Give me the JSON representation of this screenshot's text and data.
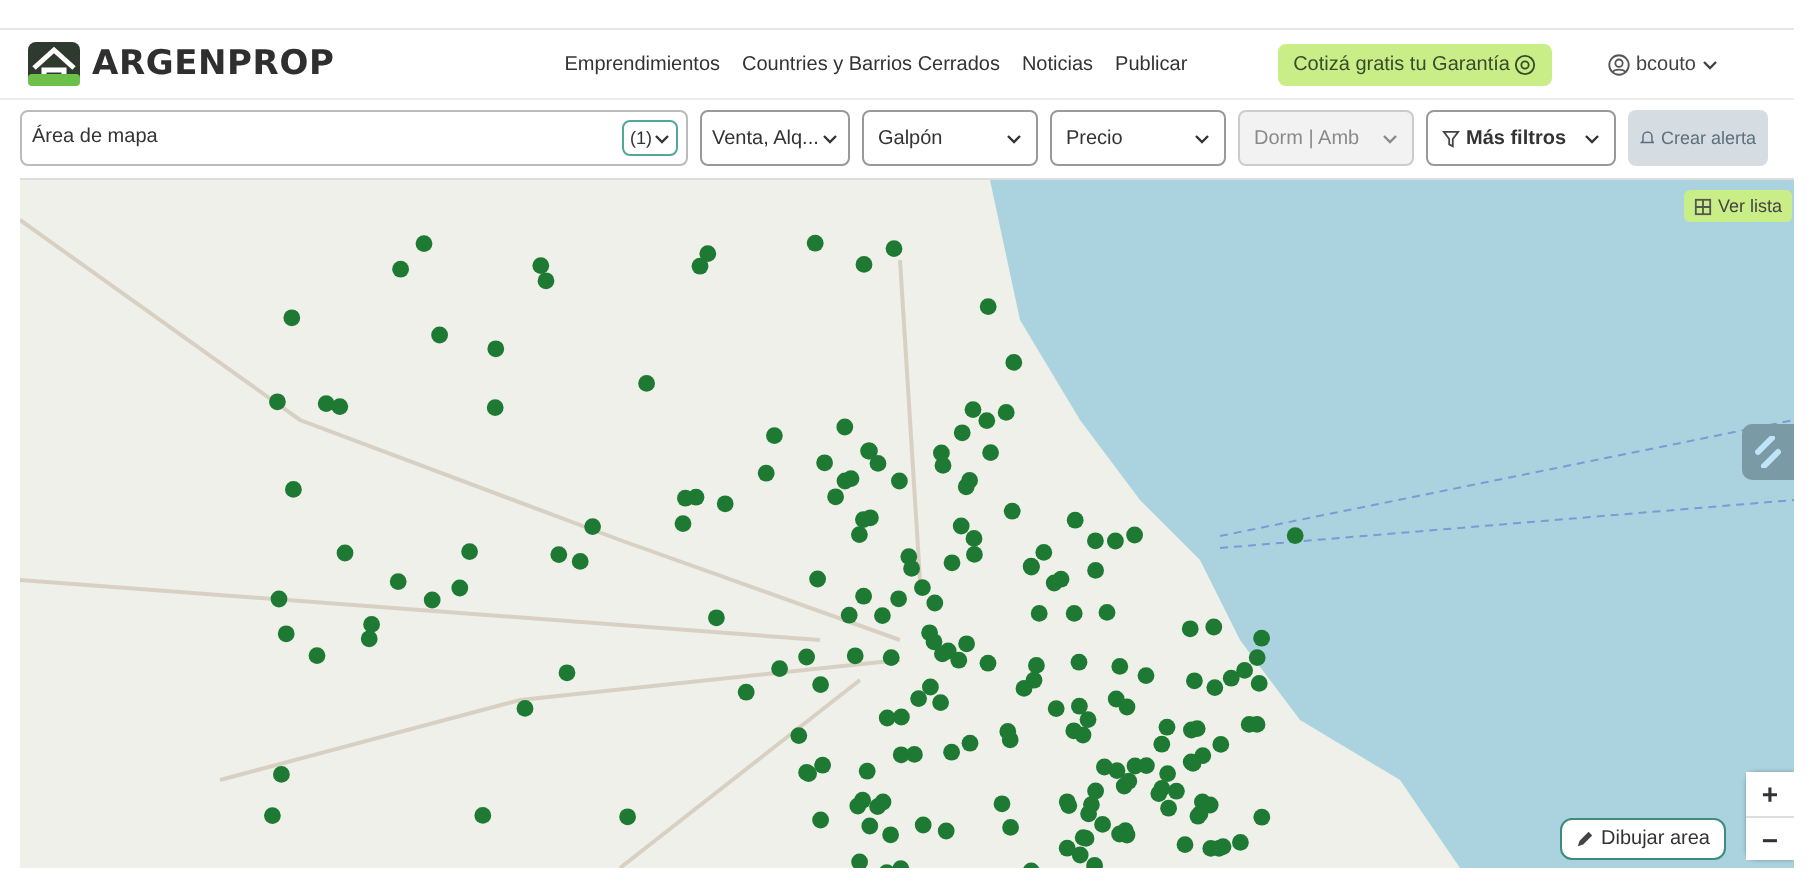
{
  "header": {
    "logo": "ARGENPROP",
    "nav": [
      "Emprendimientos",
      "Countries y Barrios Cerrados",
      "Noticias",
      "Publicar"
    ],
    "cta": "Cotizá gratis tu Garantía",
    "user": "bcouto"
  },
  "filters": {
    "area": {
      "value": "Área de mapa",
      "count": "(1)"
    },
    "dropdowns": [
      {
        "label": "Venta, Alq...",
        "kind": "plain",
        "disabled": false
      },
      {
        "label": "Galpón",
        "kind": "plain",
        "disabled": false
      },
      {
        "label": "Precio",
        "kind": "plain",
        "disabled": false
      },
      {
        "label": "Dorm | Amb",
        "kind": "plain",
        "disabled": true
      },
      {
        "label": "Más filtros",
        "kind": "filter",
        "disabled": false
      }
    ],
    "alert": {
      "label": "Crear alerta",
      "disabled": true
    }
  },
  "map": {
    "list_button": "Ver lista",
    "draw_button": "Dibujar area",
    "zoom": [
      "+",
      "−"
    ]
  }
}
